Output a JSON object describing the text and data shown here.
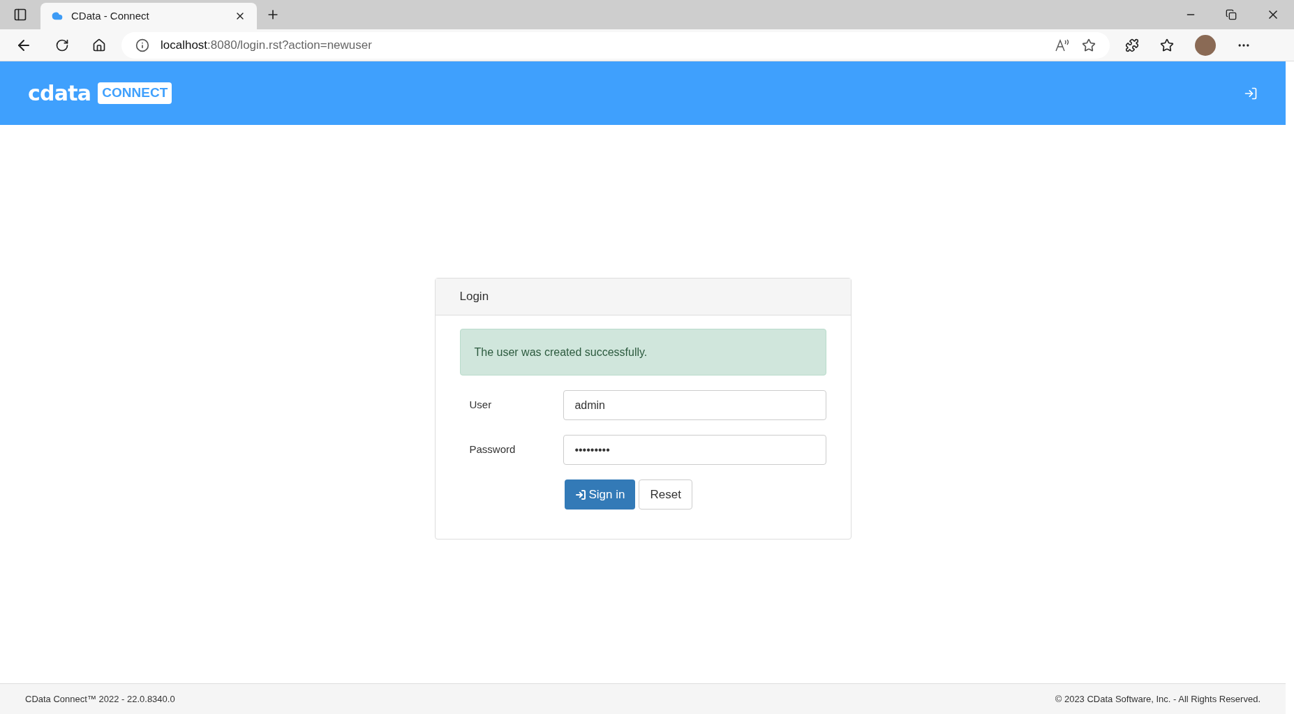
{
  "browser": {
    "tab_title": "CData - Connect",
    "url_host": "localhost",
    "url_rest": ":8080/login.rst?action=newuser"
  },
  "header": {
    "logo_word": "cdata",
    "logo_badge": "CONNECT"
  },
  "login": {
    "title": "Login",
    "alert": "The user was created successfully.",
    "fields": [
      {
        "label": "User",
        "value": "admin"
      },
      {
        "label": "Password",
        "value": "•••••••••"
      }
    ],
    "buttons": [
      {
        "label": "Sign in",
        "kind": "primary"
      },
      {
        "label": "Reset",
        "kind": "secondary"
      }
    ]
  },
  "footer": {
    "left": "CData Connect™ 2022 - 22.0.8340.0",
    "right": "© 2023 CData Software, Inc. - All Rights Reserved."
  }
}
